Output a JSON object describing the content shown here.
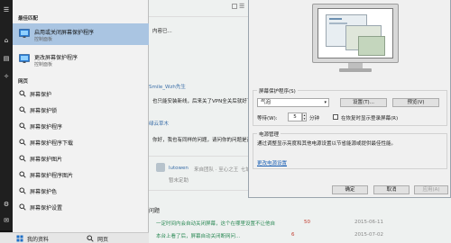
{
  "start_menu": {
    "best_match_heading": "最佳匹配",
    "apps": [
      {
        "title": "启用或关闭屏幕保护程序",
        "subtitle": "控制面板",
        "selected": true
      },
      {
        "title": "更改屏幕保护程序",
        "subtitle": "控制面板",
        "selected": false
      }
    ],
    "web_heading": "网页",
    "web_results": [
      "屏幕保护",
      "屏幕保护锁",
      "屏幕保护程序",
      "屏幕保护程序下载",
      "屏幕保护图片",
      "屏幕保护程序图片",
      "屏幕保护色",
      "屏幕保护设置"
    ],
    "bottom_left": "我的资料",
    "bottom_right": "网页"
  },
  "dialog": {
    "screensaver_label": "屏幕保护程序(S)",
    "screensaver_value": "气泡",
    "settings_button": "设置(T)...",
    "preview_button": "预览(V)",
    "wait_label": "等待(W):",
    "wait_value": "5",
    "minutes_label": "分钟",
    "resume_label": "在恢复时显示登录屏幕(R)",
    "power_group_title": "电源管理",
    "power_text_line1": "通过调整显示亮度和其他电源设置以节省能源或提供最佳性能。",
    "power_link": "更改电源设置",
    "ok_button": "确定",
    "cancel_button": "取消",
    "apply_button": "应用(A)"
  },
  "background": {
    "texts": [
      {
        "text": "内容已...",
        "cls": "bg-grey"
      },
      {
        "text": "Smile_Wzh先生",
        "cls": "bg-link"
      },
      {
        "text": "也只能安装新线，后来关了VPN全关后就好了",
        "cls": ""
      },
      {
        "text": "绿云草木",
        "cls": "bg-link"
      },
      {
        "text": "你好，我也有同样的问题，请问你的问题是否",
        "cls": ""
      },
      {
        "text": "lutowen",
        "cls": "bg-link"
      },
      {
        "text": "来自团队 · 至心之王",
        "cls": "bg-grey"
      },
      {
        "text": "七城",
        "cls": "bg-grey"
      },
      {
        "text": "暂未定助",
        "cls": "bg-grey"
      },
      {
        "text": "问题",
        "cls": ""
      },
      {
        "text": "一定时间内会自动关闭屏幕，这个在哪里设置不让他自",
        "cls": "bg-green"
      },
      {
        "text": "50",
        "cls": "bg-red"
      },
      {
        "text": "2015-06-11",
        "cls": "bg-grey"
      },
      {
        "text": "本台上看了后，屏幕自动关闭断网问...",
        "cls": "bg-green"
      },
      {
        "text": "6",
        "cls": "bg-red"
      },
      {
        "text": "2015-07-02",
        "cls": "bg-grey"
      }
    ]
  }
}
